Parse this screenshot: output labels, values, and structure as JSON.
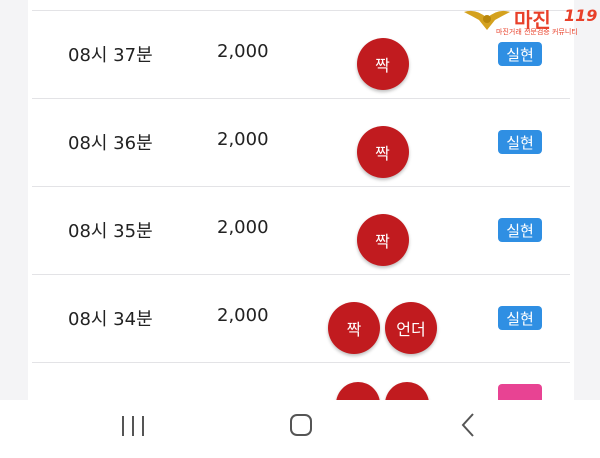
{
  "rows": [
    {
      "time": "08시 37분",
      "amount": "2,000",
      "picks": [
        "짝"
      ],
      "result": "실현",
      "result_color": "#2f8fe3"
    },
    {
      "time": "08시 36분",
      "amount": "2,000",
      "picks": [
        "짝"
      ],
      "result": "실현",
      "result_color": "#2f8fe3"
    },
    {
      "time": "08시 35분",
      "amount": "2,000",
      "picks": [
        "짝"
      ],
      "result": "실현",
      "result_color": "#2f8fe3"
    },
    {
      "time": "08시 34분",
      "amount": "2,000",
      "picks": [
        "짝",
        "언더"
      ],
      "result": "실현",
      "result_color": "#2f8fe3"
    },
    {
      "time": "",
      "amount": "",
      "picks": [
        "",
        ""
      ],
      "result": "",
      "result_color": "#e84393"
    }
  ],
  "colors": {
    "pick_ball": "#c11b1f",
    "badge_success": "#2f8fe3",
    "badge_partial": "#e84393"
  },
  "logo": {
    "name": "마진",
    "number": "119",
    "tagline": "마진거래 전문검증 커뮤니티"
  },
  "navbar": {
    "icons": [
      "recent-apps-icon",
      "home-icon",
      "back-icon"
    ]
  }
}
